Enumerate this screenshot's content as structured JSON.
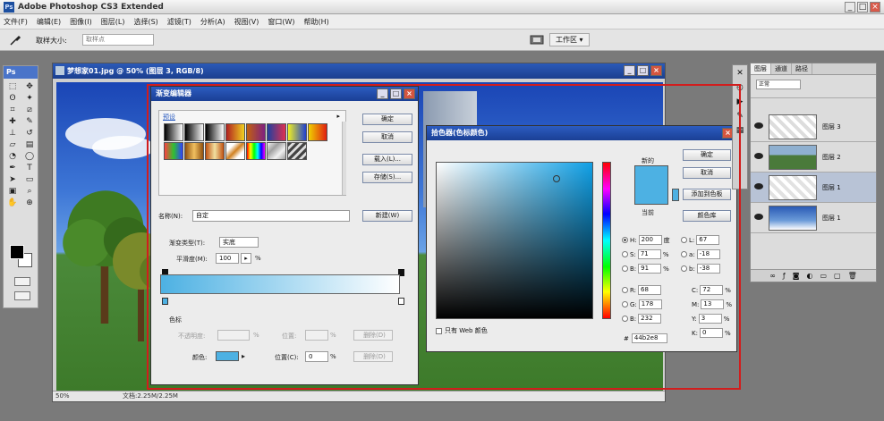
{
  "app": {
    "title": "Adobe Photoshop CS3 Extended",
    "badge": "Ps"
  },
  "menu": [
    "文件(F)",
    "编辑(E)",
    "图像(I)",
    "图层(L)",
    "选择(S)",
    "滤镜(T)",
    "分析(A)",
    "视图(V)",
    "窗口(W)",
    "帮助(H)"
  ],
  "options": {
    "label": "取样大小:",
    "sample_value": "取样点",
    "workspace": "工作区 ▾"
  },
  "toolbox": {
    "header": "Ps"
  },
  "document": {
    "title": "梦想家01.jpg @ 50% (图层 3, RGB/8)",
    "zoom": "50%",
    "status": "文档:2.25M/2.25M"
  },
  "gradient_editor": {
    "title": "渐变编辑器",
    "presets_label": "预设",
    "buttons": {
      "ok": "确定",
      "cancel": "取消",
      "load": "载入(L)...",
      "save": "存储(S)...",
      "new": "新建(W)"
    },
    "name_label": "名称(N):",
    "name_value": "自定",
    "type_label": "渐变类型(T):",
    "type_value": "实底",
    "smooth_label": "平滑度(M):",
    "smooth_value": "100",
    "smooth_unit": "%",
    "stops_label": "色标",
    "opacity_label": "不透明度:",
    "location_label": "位置:",
    "delete_label": "删除(D)",
    "color_label": "颜色:",
    "color_location_label": "位置(C):",
    "color_location_value": "0",
    "pct": "%",
    "stop_color": "#4db1e3",
    "end_color": "#ffffff"
  },
  "color_picker": {
    "title": "拾色器(色标颜色)",
    "new_label": "新的",
    "current_label": "当前",
    "buttons": {
      "ok": "确定",
      "cancel": "取消",
      "add_swatch": "添加到色板",
      "libraries": "颜色库"
    },
    "web_only": "只有 Web 颜色",
    "hsb": [
      {
        "key": "H:",
        "value": "200",
        "unit": "度"
      },
      {
        "key": "S:",
        "value": "71",
        "unit": "%"
      },
      {
        "key": "B:",
        "value": "91",
        "unit": "%"
      }
    ],
    "rgb": [
      {
        "key": "R:",
        "value": "68"
      },
      {
        "key": "G:",
        "value": "178"
      },
      {
        "key": "B:",
        "value": "232"
      }
    ],
    "lab": [
      {
        "key": "L:",
        "value": "67"
      },
      {
        "key": "a:",
        "value": "-18"
      },
      {
        "key": "b:",
        "value": "-38"
      }
    ],
    "cmyk": [
      {
        "key": "C:",
        "value": "72",
        "unit": "%"
      },
      {
        "key": "M:",
        "value": "13",
        "unit": "%"
      },
      {
        "key": "Y:",
        "value": "3",
        "unit": "%"
      },
      {
        "key": "K:",
        "value": "0",
        "unit": "%"
      }
    ],
    "hex_label": "#",
    "hex_value": "44b2e8",
    "color": "#44b2e8"
  },
  "layers_panel": {
    "tabs": [
      "图层",
      "通道",
      "路径"
    ],
    "blend_mode": "正常",
    "layers": [
      {
        "name": "图层 3",
        "selected": false
      },
      {
        "name": "图层 2",
        "selected": false
      },
      {
        "name": "图层 1",
        "selected": true
      },
      {
        "name": "图层 1",
        "selected": false
      }
    ]
  }
}
